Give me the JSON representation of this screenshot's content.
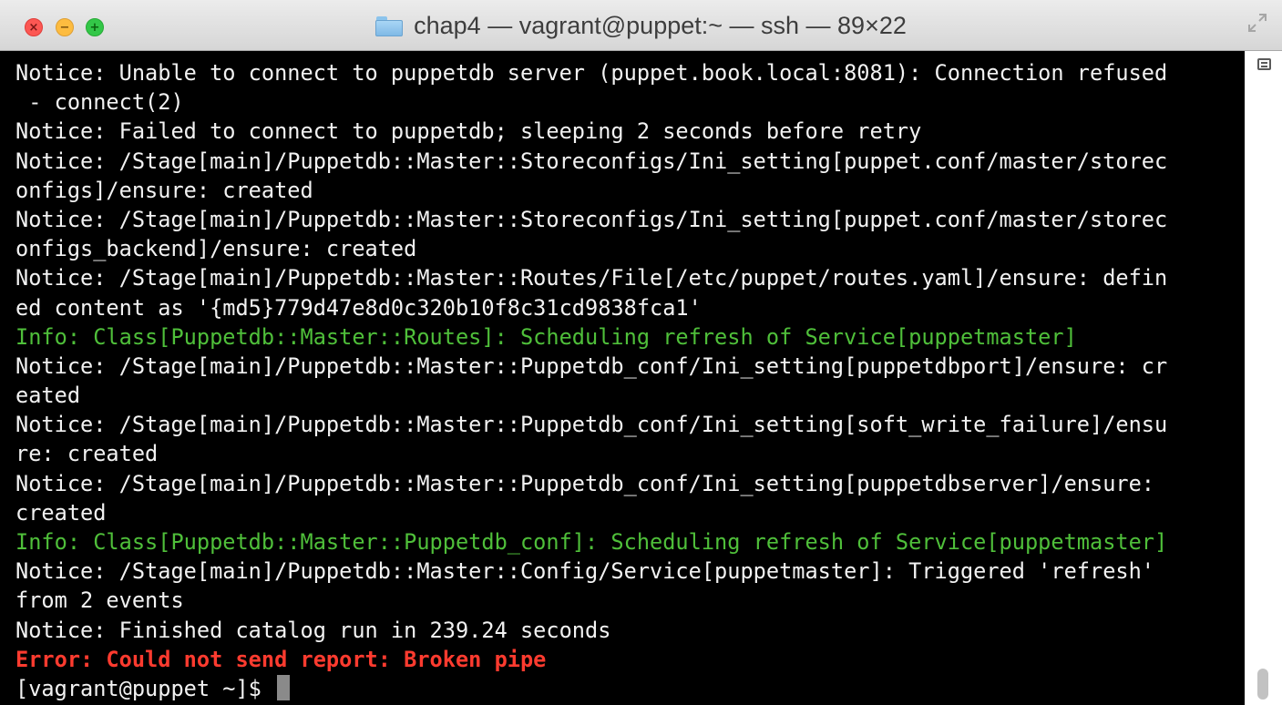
{
  "window": {
    "title": "chap4 — vagrant@puppet:~ — ssh — 89×22"
  },
  "terminal": {
    "lines": [
      {
        "text": "Notice: Unable to connect to puppetdb server (puppet.book.local:8081): Connection refused",
        "type": "notice"
      },
      {
        "text": " - connect(2)",
        "type": "notice"
      },
      {
        "text": "Notice: Failed to connect to puppetdb; sleeping 2 seconds before retry",
        "type": "notice"
      },
      {
        "text": "Notice: /Stage[main]/Puppetdb::Master::Storeconfigs/Ini_setting[puppet.conf/master/storec",
        "type": "notice"
      },
      {
        "text": "onfigs]/ensure: created",
        "type": "notice"
      },
      {
        "text": "Notice: /Stage[main]/Puppetdb::Master::Storeconfigs/Ini_setting[puppet.conf/master/storec",
        "type": "notice"
      },
      {
        "text": "onfigs_backend]/ensure: created",
        "type": "notice"
      },
      {
        "text": "Notice: /Stage[main]/Puppetdb::Master::Routes/File[/etc/puppet/routes.yaml]/ensure: defin",
        "type": "notice"
      },
      {
        "text": "ed content as '{md5}779d47e8d0c320b10f8c31cd9838fca1'",
        "type": "notice"
      },
      {
        "text": "Info: Class[Puppetdb::Master::Routes]: Scheduling refresh of Service[puppetmaster]",
        "type": "info"
      },
      {
        "text": "Notice: /Stage[main]/Puppetdb::Master::Puppetdb_conf/Ini_setting[puppetdbport]/ensure: cr",
        "type": "notice"
      },
      {
        "text": "eated",
        "type": "notice"
      },
      {
        "text": "Notice: /Stage[main]/Puppetdb::Master::Puppetdb_conf/Ini_setting[soft_write_failure]/ensu",
        "type": "notice"
      },
      {
        "text": "re: created",
        "type": "notice"
      },
      {
        "text": "Notice: /Stage[main]/Puppetdb::Master::Puppetdb_conf/Ini_setting[puppetdbserver]/ensure:",
        "type": "notice"
      },
      {
        "text": "created",
        "type": "notice"
      },
      {
        "text": "Info: Class[Puppetdb::Master::Puppetdb_conf]: Scheduling refresh of Service[puppetmaster]",
        "type": "info"
      },
      {
        "text": "Notice: /Stage[main]/Puppetdb::Master::Config/Service[puppetmaster]: Triggered 'refresh'",
        "type": "notice"
      },
      {
        "text": "from 2 events",
        "type": "notice"
      },
      {
        "text": "Notice: Finished catalog run in 239.24 seconds",
        "type": "notice"
      },
      {
        "text": "Error: Could not send report: Broken pipe",
        "type": "error"
      }
    ],
    "prompt": "[vagrant@puppet ~]$ "
  },
  "icons": {
    "close": "close-icon",
    "minimize": "minimize-icon",
    "zoom": "zoom-icon",
    "folder": "folder-icon",
    "fullscreen": "fullscreen-arrows-icon",
    "scrollback": "scrollback-list-icon"
  },
  "colors": {
    "background": "#000000",
    "text": "#f2f2f2",
    "info": "#4fbf3a",
    "error": "#ff3b2f"
  }
}
